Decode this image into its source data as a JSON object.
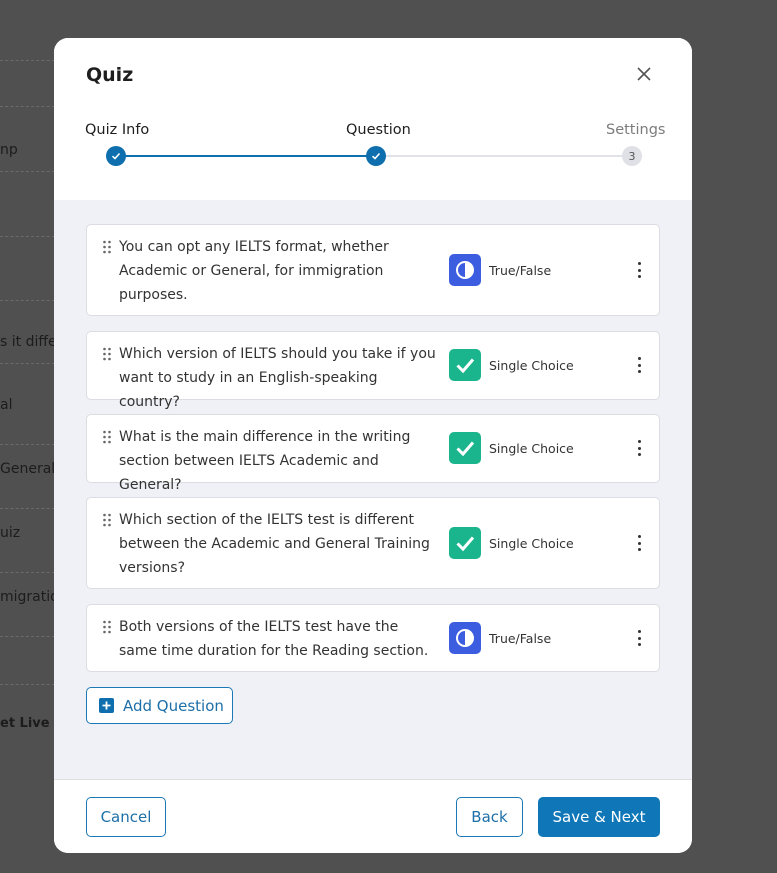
{
  "background": {
    "fragments": [
      "np",
      "s it diffe",
      "al",
      "General a",
      "uiz",
      "migration",
      "et Live L"
    ]
  },
  "modal": {
    "title": "Quiz",
    "close_icon": "close-icon"
  },
  "stepper": {
    "steps": [
      {
        "label": "Quiz Info",
        "state": "done"
      },
      {
        "label": "Question",
        "state": "done"
      },
      {
        "label": "Settings",
        "state": "pending",
        "number": "3"
      }
    ],
    "accent_color": "#0f6fae"
  },
  "questions": [
    {
      "text": "You can opt any IELTS format, whether Academic or General, for immigration purposes.",
      "type": "True/False",
      "type_icon": "half-circle-icon"
    },
    {
      "text": "Which version of IELTS should you take if you want to study in an English-speaking country?",
      "type": "Single Choice",
      "type_icon": "checkmark-icon"
    },
    {
      "text": "What is the main difference in the writing section between IELTS Academic and General?",
      "type": "Single Choice",
      "type_icon": "checkmark-icon"
    },
    {
      "text": "Which section of the IELTS test is different between the Academic and General Training versions?",
      "type": "Single Choice",
      "type_icon": "checkmark-icon"
    },
    {
      "text": "Both versions of the IELTS test have the same time duration for the Reading section.",
      "type": "True/False",
      "type_icon": "half-circle-icon"
    }
  ],
  "add_question_label": "Add Question",
  "footer": {
    "cancel_label": "Cancel",
    "back_label": "Back",
    "save_next_label": "Save & Next"
  },
  "colors": {
    "true_false": "#3c5de0",
    "single_choice": "#1ab58c",
    "primary": "#0f77b8"
  }
}
